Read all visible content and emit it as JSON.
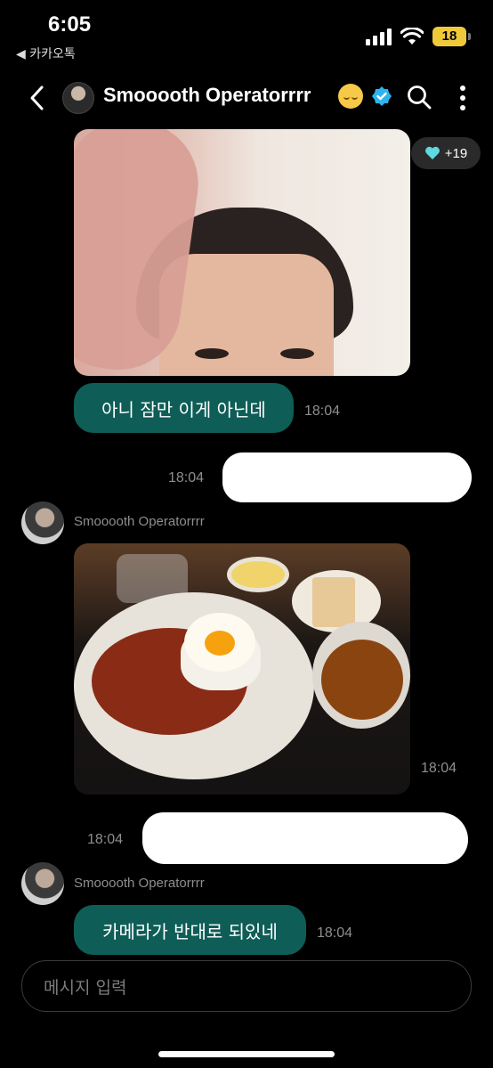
{
  "status_bar": {
    "time": "6:05",
    "back_app": "◀ 카카오톡",
    "battery": "18"
  },
  "header": {
    "title": "Smooooth Operatorrrr",
    "icons": [
      "back-chevron-icon",
      "sleepy-face-emoji-icon",
      "verified-badge-icon",
      "search-icon",
      "more-vertical-icon"
    ]
  },
  "messages": {
    "reaction": {
      "icon": "heart-icon",
      "count": "+19",
      "color": "#5fd8e0"
    },
    "m1_text": "아니 잠만 이게 아닌데",
    "m1_time": "18:04",
    "m2_time": "18:04",
    "sender_1": "Smooooth Operatorrrr",
    "m3_time": "18:04",
    "m4_time": "18:04",
    "sender_2": "Smooooth Operatorrrr",
    "m5_text": "카메라가 반대로 되있네",
    "m5_time": "18:04"
  },
  "composer": {
    "placeholder": "메시지 입력"
  },
  "colors": {
    "bubble": "#0f5d57",
    "background": "#000000",
    "timestamp": "#8e8e8e",
    "verified": "#2fb3f0"
  }
}
